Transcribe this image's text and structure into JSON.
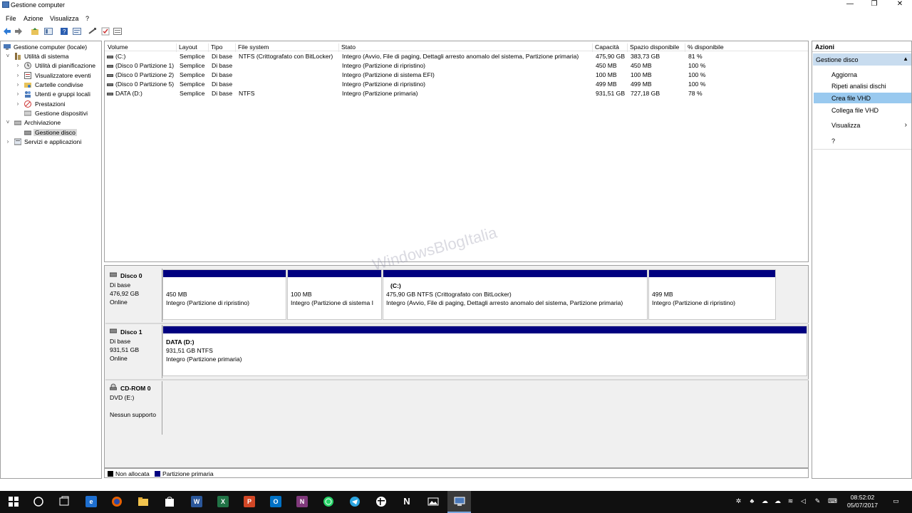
{
  "window": {
    "title": "Gestione computer",
    "minimize": "—",
    "restore": "❐",
    "close": "✕"
  },
  "menu": [
    "File",
    "Azione",
    "Visualizza",
    "?"
  ],
  "tree": [
    {
      "label": "Gestione computer (locale)",
      "indent": 0,
      "chevron": "",
      "icon": "computer-management-icon"
    },
    {
      "label": "Utilità di sistema",
      "indent": 1,
      "chevron": "˅",
      "icon": "system-tools-icon"
    },
    {
      "label": "Utilità di pianificazione",
      "indent": 2,
      "chevron": "›",
      "icon": "task-scheduler-icon"
    },
    {
      "label": "Visualizzatore eventi",
      "indent": 2,
      "chevron": "›",
      "icon": "event-viewer-icon"
    },
    {
      "label": "Cartelle condivise",
      "indent": 2,
      "chevron": "›",
      "icon": "shared-folders-icon"
    },
    {
      "label": "Utenti e gruppi locali",
      "indent": 2,
      "chevron": "›",
      "icon": "users-groups-icon"
    },
    {
      "label": "Prestazioni",
      "indent": 2,
      "chevron": "›",
      "icon": "performance-icon"
    },
    {
      "label": "Gestione dispositivi",
      "indent": 2,
      "chevron": "",
      "icon": "device-manager-icon"
    },
    {
      "label": "Archiviazione",
      "indent": 1,
      "chevron": "˅",
      "icon": "storage-icon"
    },
    {
      "label": "Gestione disco",
      "indent": 2,
      "chevron": "",
      "icon": "disk-management-icon",
      "selected": true
    },
    {
      "label": "Servizi e applicazioni",
      "indent": 1,
      "chevron": "›",
      "icon": "services-apps-icon"
    }
  ],
  "volumes": {
    "headers": [
      "Volume",
      "Layout",
      "Tipo",
      "File system",
      "Stato",
      "Capacità",
      "Spazio disponibile",
      "% disponibile"
    ],
    "rows": [
      [
        "(C:)",
        "Semplice",
        "Di base",
        "NTFS (Crittografato con BitLocker)",
        "Integro (Avvio, File di paging, Dettagli arresto anomalo del sistema, Partizione primaria)",
        "475,90 GB",
        "383,73 GB",
        "81 %"
      ],
      [
        "(Disco 0 Partizione 1)",
        "Semplice",
        "Di base",
        "",
        "Integro (Partizione di ripristino)",
        "450 MB",
        "450 MB",
        "100 %"
      ],
      [
        "(Disco 0 Partizione 2)",
        "Semplice",
        "Di base",
        "",
        "Integro (Partizione di sistema EFI)",
        "100 MB",
        "100 MB",
        "100 %"
      ],
      [
        "(Disco 0 Partizione 5)",
        "Semplice",
        "Di base",
        "",
        "Integro (Partizione di ripristino)",
        "499 MB",
        "499 MB",
        "100 %"
      ],
      [
        "DATA (D:)",
        "Semplice",
        "Di base",
        "NTFS",
        "Integro (Partizione primaria)",
        "931,51 GB",
        "727,18 GB",
        "78 %"
      ]
    ]
  },
  "disks": [
    {
      "name": "Disco 0",
      "type": "Di base",
      "size": "476,92 GB",
      "status": "Online",
      "partitions": [
        {
          "title": "",
          "size": "450 MB",
          "status": "Integro (Partizione di ripristino)"
        },
        {
          "title": "",
          "size": "100 MB",
          "status": "Integro (Partizione di sistema I"
        },
        {
          "title": "(C:)",
          "size": "475,90 GB NTFS (Crittografato con BitLocker)",
          "status": "Integro (Avvio, File di paging, Dettagli arresto anomalo del sistema, Partizione primaria)"
        },
        {
          "title": "",
          "size": "499 MB",
          "status": "Integro (Partizione di ripristino)"
        }
      ]
    },
    {
      "name": "Disco 1",
      "type": "Di base",
      "size": "931,51 GB",
      "status": "Online",
      "partitions": [
        {
          "title": "DATA  (D:)",
          "size": "931,51 GB NTFS",
          "status": "Integro (Partizione primaria)"
        }
      ]
    },
    {
      "name": "CD-ROM 0",
      "type": "DVD (E:)",
      "size": "",
      "status": "Nessun supporto",
      "partitions": []
    }
  ],
  "legend": [
    {
      "label": "Non allocata",
      "color": "#000000"
    },
    {
      "label": "Partizione primaria",
      "color": "#000080"
    }
  ],
  "actions": {
    "title": "Azioni",
    "group": "Gestione disco",
    "group_arrow": "▲",
    "items": [
      "Aggiorna",
      "Ripeti analisi dischi",
      "Crea file VHD",
      "Collega file VHD",
      "Visualizza",
      "?"
    ],
    "submenu_arrow": "›"
  },
  "watermark": "WindowsBlogItalia",
  "taskbar": {
    "time": "08:52:02",
    "date": "05/07/2017",
    "apps": [
      {
        "icon": "start-icon",
        "glyph": ""
      },
      {
        "icon": "cortana-icon",
        "glyph": ""
      },
      {
        "icon": "task-view-icon",
        "glyph": ""
      },
      {
        "icon": "edge-icon",
        "glyph": "e"
      },
      {
        "icon": "firefox-icon",
        "glyph": ""
      },
      {
        "icon": "file-explorer-icon",
        "glyph": ""
      },
      {
        "icon": "store-icon",
        "glyph": ""
      },
      {
        "icon": "word-icon",
        "glyph": "W"
      },
      {
        "icon": "excel-icon",
        "glyph": "X"
      },
      {
        "icon": "powerpoint-icon",
        "glyph": "P"
      },
      {
        "icon": "outlook-icon",
        "glyph": "O"
      },
      {
        "icon": "onenote-icon",
        "glyph": "N"
      },
      {
        "icon": "whatsapp-icon",
        "glyph": ""
      },
      {
        "icon": "telegram-icon",
        "glyph": ""
      },
      {
        "icon": "slack-icon",
        "glyph": ""
      },
      {
        "icon": "notion-icon",
        "glyph": "N"
      },
      {
        "icon": "photos-icon",
        "glyph": ""
      },
      {
        "icon": "computer-management-taskbar-icon",
        "glyph": ""
      }
    ]
  },
  "colors": {
    "partition_bar": "#000080",
    "selection": "#99c9ef",
    "group_header": "#c8dcef",
    "taskbar": "#101010"
  }
}
